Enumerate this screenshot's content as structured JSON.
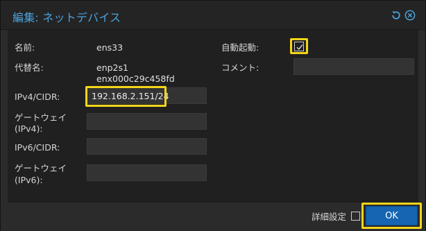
{
  "dialog": {
    "title": "編集: ネットデバイス"
  },
  "icons": {
    "reset": "reset-icon",
    "close": "close-icon",
    "accent": "#4aa3df"
  },
  "form": {
    "name_label": "名前:",
    "name_value": "ens33",
    "altname_label": "代替名:",
    "altname_values": [
      "enp2s1",
      "enx000c29c458fd"
    ],
    "ipv4_cidr_label": "IPv4/CIDR:",
    "ipv4_cidr_value": "192.168.2.151/24",
    "gateway4_label_line1": "ゲートウェイ",
    "gateway4_label_line2": "(IPv4):",
    "gateway4_value": "",
    "ipv6_cidr_label": "IPv6/CIDR:",
    "ipv6_cidr_value": "",
    "gateway6_label_line1": "ゲートウェイ",
    "gateway6_label_line2": "(IPv6):",
    "gateway6_value": "",
    "autostart_label": "自動起動:",
    "autostart_checked": true,
    "comment_label": "コメント:",
    "comment_value": ""
  },
  "footer": {
    "advanced_label": "詳細設定",
    "advanced_checked": false,
    "ok_label": "OK",
    "ok_color": "#1565b2",
    "highlight_color": "#f4d61a"
  }
}
